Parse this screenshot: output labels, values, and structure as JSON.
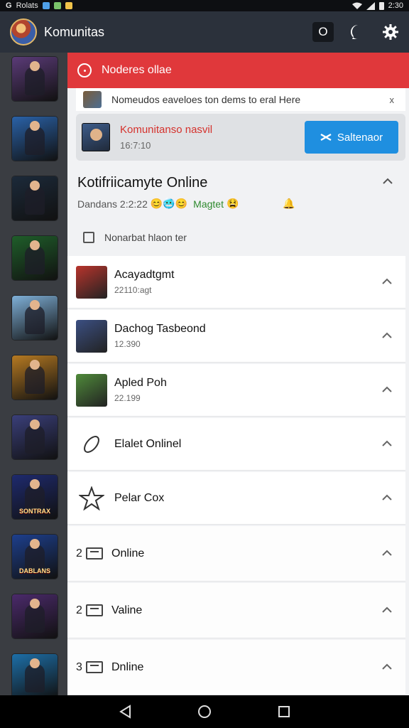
{
  "status_bar": {
    "app_label": "Rolats",
    "time": "2:30",
    "left_icons": [
      "notification-square-icon",
      "photo-square-icon",
      "mail-square-icon"
    ],
    "right_icons": [
      "wifi-icon",
      "signal-icon",
      "battery-icon"
    ]
  },
  "app_bar": {
    "title": "Komunitas",
    "action_o_label": "O"
  },
  "rail": {
    "thumbs": [
      {
        "name": "game-thumb-1",
        "bg": "#5b3b78"
      },
      {
        "name": "game-thumb-2",
        "bg": "#2a62a8"
      },
      {
        "name": "game-thumb-3",
        "bg": "#1c2a3a"
      },
      {
        "name": "game-thumb-4",
        "bg": "#1f5e2a"
      },
      {
        "name": "game-thumb-5",
        "bg": "#7fb0d8"
      },
      {
        "name": "game-thumb-6",
        "bg": "#b67a22"
      },
      {
        "name": "game-thumb-7",
        "bg": "#3a3f7a"
      },
      {
        "name": "game-thumb-8",
        "bg": "#1e2a6e",
        "tag": "SONTRAX"
      },
      {
        "name": "game-thumb-9",
        "bg": "#1d3f8d",
        "tag": "DABLANS"
      },
      {
        "name": "game-thumb-10",
        "bg": "#4b2a6b"
      },
      {
        "name": "game-thumb-11",
        "bg": "#1d6fa8"
      }
    ]
  },
  "alert": {
    "text": "Noderes ollae"
  },
  "notice": {
    "text": "Nomeudos eaveloes ton dems to eral Here",
    "close_label": "x"
  },
  "featured": {
    "title": "Komunitanso nasvil",
    "time": "16:7:10",
    "button_label": "Saltenaor"
  },
  "section": {
    "heading": "Kotifriicamyte Online",
    "sub_prefix": "Dandans 2:2:22",
    "sub_emojis": "😊🥶😊",
    "sub_green": "Magtet",
    "sub_emoji2": "😫",
    "bell": "🔔",
    "row3_text": "Nonarbat hlaon ter"
  },
  "list_items": [
    {
      "type": "game",
      "title": "Acayadtgmt",
      "sub": "22110:agt",
      "color": "#b8342c"
    },
    {
      "type": "game",
      "title": "Dachog Tasbeond",
      "sub": "12.390",
      "color": "#3b4f82"
    },
    {
      "type": "game",
      "title": "Apled Poh",
      "sub": "22.199",
      "color": "#4f8a3a"
    },
    {
      "type": "icon",
      "title": "Elalet Onlinel",
      "icon": "leaf-icon"
    },
    {
      "type": "icon",
      "title": "Pelar Cox",
      "icon": "star-icon"
    },
    {
      "type": "folder",
      "num": "2",
      "title": "Online"
    },
    {
      "type": "folder",
      "num": "2",
      "title": "Valine"
    },
    {
      "type": "folder",
      "num": "3",
      "title": "Dnline"
    }
  ]
}
